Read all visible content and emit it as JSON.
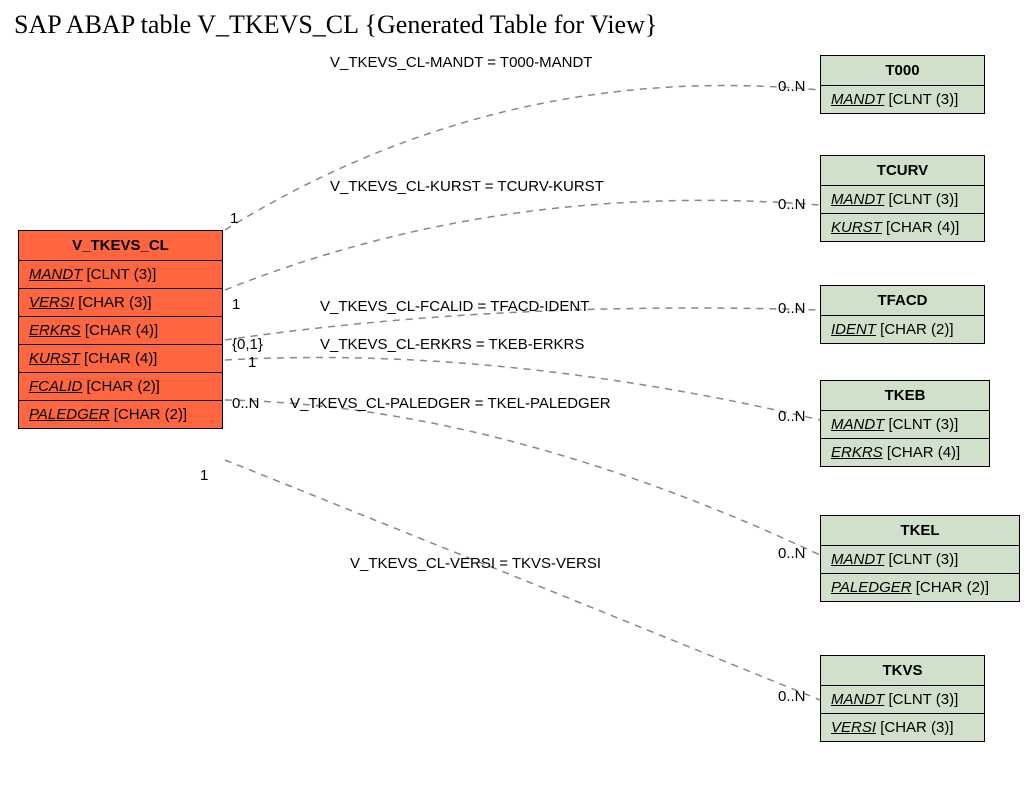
{
  "title": "SAP ABAP table V_TKEVS_CL {Generated Table for View}",
  "main_entity": {
    "name": "V_TKEVS_CL",
    "fields": [
      {
        "name": "MANDT",
        "type": "[CLNT (3)]"
      },
      {
        "name": "VERSI",
        "type": "[CHAR (3)]"
      },
      {
        "name": "ERKRS",
        "type": "[CHAR (4)]"
      },
      {
        "name": "KURST",
        "type": "[CHAR (4)]"
      },
      {
        "name": "FCALID",
        "type": "[CHAR (2)]"
      },
      {
        "name": "PALEDGER",
        "type": "[CHAR (2)]"
      }
    ]
  },
  "related": [
    {
      "name": "T000",
      "fields": [
        {
          "name": "MANDT",
          "type": "[CLNT (3)]"
        }
      ]
    },
    {
      "name": "TCURV",
      "fields": [
        {
          "name": "MANDT",
          "type": "[CLNT (3)]"
        },
        {
          "name": "KURST",
          "type": "[CHAR (4)]"
        }
      ]
    },
    {
      "name": "TFACD",
      "fields": [
        {
          "name": "IDENT",
          "type": "[CHAR (2)]"
        }
      ]
    },
    {
      "name": "TKEB",
      "fields": [
        {
          "name": "MANDT",
          "type": "[CLNT (3)]"
        },
        {
          "name": "ERKRS",
          "type": "[CHAR (4)]"
        }
      ]
    },
    {
      "name": "TKEL",
      "fields": [
        {
          "name": "MANDT",
          "type": "[CLNT (3)]"
        },
        {
          "name": "PALEDGER",
          "type": "[CHAR (2)]"
        }
      ]
    },
    {
      "name": "TKVS",
      "fields": [
        {
          "name": "MANDT",
          "type": "[CLNT (3)]"
        },
        {
          "name": "VERSI",
          "type": "[CHAR (3)]"
        }
      ]
    }
  ],
  "relations": [
    {
      "label": "V_TKEVS_CL-MANDT = T000-MANDT",
      "left_card": "1",
      "right_card": "0..N"
    },
    {
      "label": "V_TKEVS_CL-KURST = TCURV-KURST",
      "left_card": "1",
      "right_card": "0..N"
    },
    {
      "label": "V_TKEVS_CL-FCALID = TFACD-IDENT",
      "left_card": "{0,1}",
      "right_card": "0..N"
    },
    {
      "label": "V_TKEVS_CL-ERKRS = TKEB-ERKRS",
      "left_card": "1",
      "right_card": ""
    },
    {
      "label": "V_TKEVS_CL-PALEDGER = TKEL-PALEDGER",
      "left_card": "0..N",
      "right_card": "0..N"
    },
    {
      "label": "V_TKEVS_CL-VERSI = TKVS-VERSI",
      "left_card": "1",
      "right_card": "0..N"
    }
  ],
  "extra_card": "0..N"
}
